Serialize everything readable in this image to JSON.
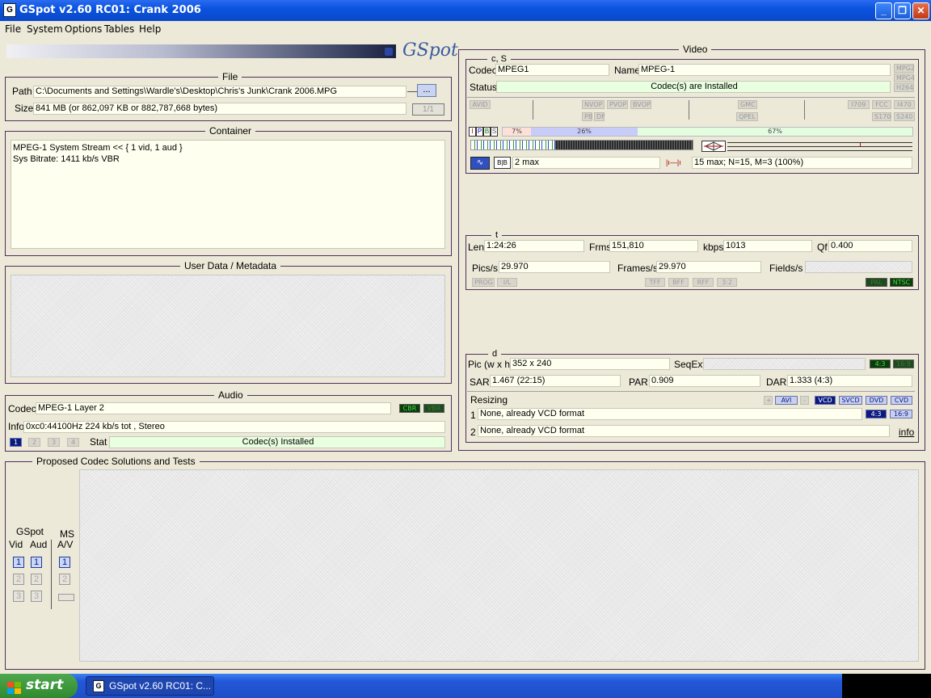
{
  "window": {
    "title": "GSpot v2.60 RC01: Crank 2006",
    "icon": "gspot-app-icon",
    "min": "_",
    "max": "❐",
    "close": "✕"
  },
  "menu": [
    "File",
    "System",
    "Options",
    "Tables",
    "Help"
  ],
  "logo": "GSpot",
  "file": {
    "title": "File",
    "path_label": "Path",
    "path": "C:\\Documents and Settings\\Wardle's\\Desktop\\Chris's Junk\\Crank 2006.MPG",
    "browse": "...",
    "size_label": "Size",
    "size": "841 MB (or 862,097 KB or 882,787,668 bytes)",
    "page": "1/1"
  },
  "container": {
    "title": "Container",
    "lines": [
      "MPEG-1 System Stream << { 1 vid, 1 aud }",
      "Sys Bitrate: 1411 kb/s VBR"
    ]
  },
  "userdata": {
    "title": "User Data / Metadata"
  },
  "audio": {
    "title": "Audio",
    "codec_label": "Codec",
    "codec": "MPEG-1 Layer 2",
    "cbr": "CBR",
    "vbr": "VBR",
    "info_label": "Info",
    "info": "0xc0:44100Hz  224 kb/s tot , Stereo",
    "streams": [
      "1",
      "2",
      "3",
      "4"
    ],
    "stat_label": "Stat",
    "stat": "Codec(s) Installed"
  },
  "video": {
    "title": "Video",
    "cs": {
      "title": "c, S",
      "codec_label": "Codec",
      "codec": "MPEG1",
      "name_label": "Name",
      "name": "MPEG-1",
      "status_label": "Status",
      "status": "Codec(s) are Installed",
      "side": [
        "MPG2",
        "MPG4",
        "H264"
      ]
    },
    "flags": {
      "avid": "AVID",
      "nvop": "NVOP",
      "pvop": "PVOP",
      "bvop": "BVOP",
      "pb": "PB",
      "df": "DF",
      "gmc": "GMC",
      "qpel": "QPEL",
      "i709": "I709",
      "fcc": "FCC",
      "i470": "I470",
      "s170": "S170",
      "s240": "S240"
    },
    "frames": {
      "types": [
        "I",
        "P",
        "B",
        "S"
      ],
      "i_pct": "7%",
      "p_pct": "26%",
      "b_pct": "67%",
      "i_frac": 0.07,
      "p_frac": 0.26,
      "b_frac": 0.67
    },
    "gop": {
      "bb": "B|B",
      "bmax": "2 max",
      "gopinfo": "15 max; N=15, M=3 (100%)"
    },
    "t": {
      "title": "t",
      "len_label": "Len",
      "len": "1:24:26",
      "frms_label": "Frms",
      "frms": "151,810",
      "kbps_label": "kbps",
      "kbps": "1013",
      "qf_label": "Qf",
      "qf": "0.400",
      "pics_label": "Pics/s",
      "pics": "29.970",
      "framess_label": "Frames/s",
      "framess": "29.970",
      "fields_label": "Fields/s",
      "prog": "PROG",
      "il": "I/L",
      "tff": "TFF",
      "bff": "BFF",
      "rff": "RFF",
      "pd": "3:2",
      "pal": "PAL",
      "ntsc": "NTSC"
    },
    "d": {
      "title": "d",
      "pic_label": "Pic (w x h)",
      "pic": "352 x 240",
      "seqext_label": "SeqExt",
      "ar43": "4:3",
      "ar169": "16:9",
      "sar_label": "SAR",
      "sar": "1.467 (22:15)",
      "par_label": "PAR",
      "par": "0.909",
      "dar_label": "DAR",
      "dar": "1.333 (4:3)",
      "resizing_label": "Resizing",
      "plus": "+",
      "avi": "AVI",
      "minus": "-",
      "vcd": "VCD",
      "svcd": "SVCD",
      "dvd": "DVD",
      "cvd": "CVD",
      "r1_n": "1",
      "r1": "None, already VCD format",
      "r2_n": "2",
      "r2": "None, already VCD format",
      "ar43b": "4:3",
      "ar169b": "16:9",
      "info": "info"
    }
  },
  "proposed": {
    "title": "Proposed Codec Solutions and Tests",
    "gspot": "GSpot",
    "vid": "Vid",
    "aud": "Aud",
    "ms": "MS",
    "av": "A/V",
    "n1": "1",
    "n2": "2",
    "n3": "3"
  },
  "taskbar": {
    "start": "start",
    "item": "GSpot v2.60 RC01: C..."
  }
}
